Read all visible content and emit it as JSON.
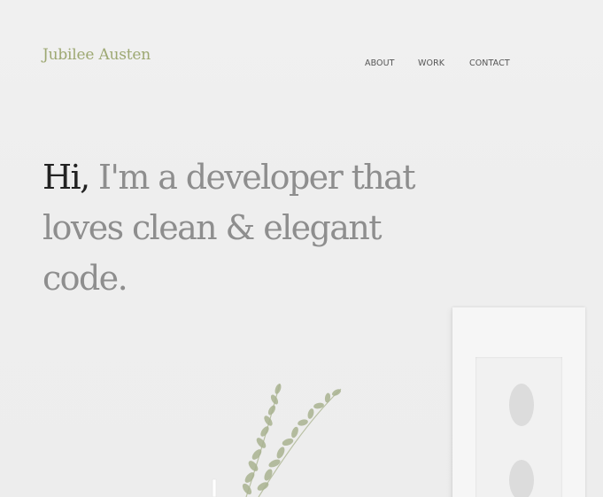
{
  "header": {
    "logo_text": "Jubilee Austen",
    "nav": [
      {
        "label": "ABOUT"
      },
      {
        "label": "WORK"
      },
      {
        "label": "CONTACT"
      }
    ]
  },
  "hero": {
    "greeting": "Hi,",
    "headline_rest": " I'm a developer that loves clean & elegant code."
  },
  "colors": {
    "logo": "#9da872",
    "headline": "#8e8e8e",
    "greeting": "#222222",
    "nav_text": "#555555",
    "background": "#eeeeee"
  },
  "decor": {
    "picture_frame_icon": "picture-frame",
    "plant_icon": "eucalyptus-plant"
  }
}
